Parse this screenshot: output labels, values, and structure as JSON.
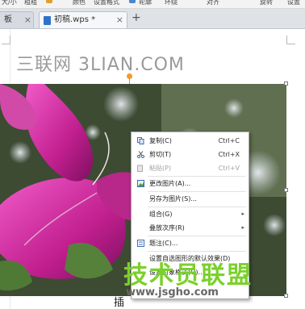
{
  "ribbon": {
    "items": [
      "大/小",
      "粗粗",
      "颜色",
      "设置格式",
      "轮廓",
      "环绕",
      "对齐",
      "旋转",
      "设置"
    ]
  },
  "tabs": {
    "left_label": "板",
    "left_close": "×",
    "active_label": "初稿.wps *",
    "active_close": "×",
    "new_tab": "+"
  },
  "document": {
    "header_text": "三联网 3LIAN.COM",
    "caption": "插"
  },
  "context_menu": {
    "items": [
      {
        "label": "复制(C)",
        "shortcut": "Ctrl+C",
        "icon": "copy-icon",
        "enabled": true
      },
      {
        "label": "剪切(T)",
        "shortcut": "Ctrl+X",
        "icon": "scissors-icon",
        "enabled": true
      },
      {
        "label": "粘贴(P)",
        "shortcut": "Ctrl+V",
        "icon": "paste-icon",
        "enabled": false
      },
      {
        "label": "更改图片(A)...",
        "shortcut": "",
        "icon": "change-picture-icon",
        "enabled": true
      },
      {
        "label": "另存为图片(S)...",
        "shortcut": "",
        "icon": "",
        "enabled": true
      },
      {
        "label": "组合(G)",
        "shortcut": "",
        "icon": "",
        "enabled": true,
        "submenu": true
      },
      {
        "label": "叠放次序(R)",
        "shortcut": "",
        "icon": "",
        "enabled": true,
        "submenu": true
      },
      {
        "label": "题注(C)...",
        "shortcut": "",
        "icon": "caption-icon",
        "enabled": true
      },
      {
        "label": "设置自选图形的默认效果(D)",
        "shortcut": "",
        "icon": "",
        "enabled": true
      },
      {
        "label": "设置对象格式(O)...",
        "shortcut": "",
        "icon": "",
        "enabled": true
      }
    ],
    "submenu_arrow": "▸"
  },
  "watermark": {
    "logo": "技术员联盟",
    "url": "www.jsgho.com"
  },
  "colors": {
    "accent": "#2f73c9",
    "handle_rotate": "#f19a2a",
    "watermark_green": "#7ad12a"
  }
}
